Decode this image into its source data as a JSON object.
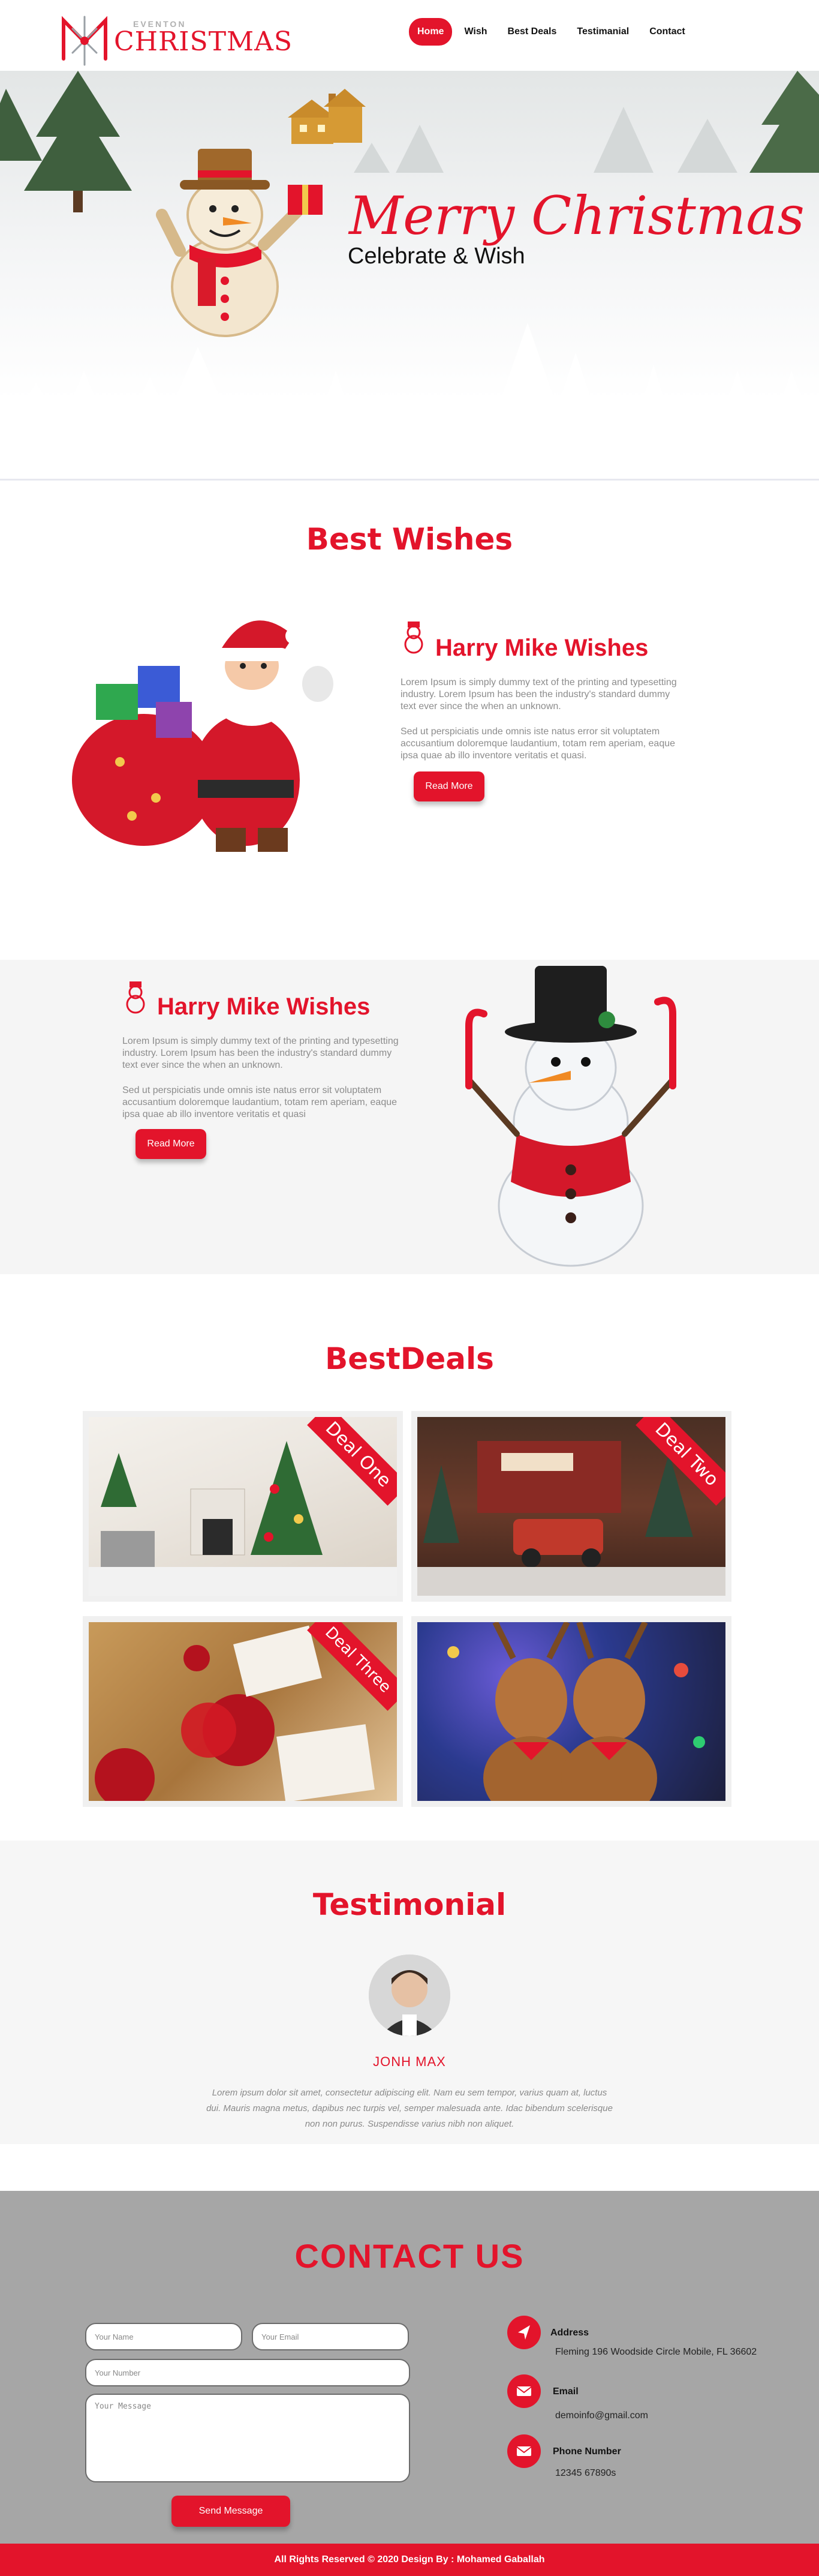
{
  "logo": {
    "sub": "EVENTON",
    "main": "CHRISTMAS"
  },
  "nav": {
    "items": [
      {
        "label": "Home"
      },
      {
        "label": "Wish"
      },
      {
        "label": "Best Deals"
      },
      {
        "label": "Testimanial"
      },
      {
        "label": "Contact"
      }
    ],
    "active": "Home"
  },
  "hero": {
    "title": "Merry Christmas",
    "subtitle": "Celebrate & Wish"
  },
  "best_wishes": {
    "title": "Best Wishes",
    "blocks": [
      {
        "heading": "Harry Mike Wishes",
        "para1": "Lorem Ipsum is simply dummy text of the printing and typesetting industry. Lorem Ipsum has been the industry's standard dummy text ever since the when an unknown.",
        "para2": "Sed ut perspiciatis unde omnis iste natus error sit voluptatem accusantium doloremque laudantium, totam rem aperiam, eaque ipsa quae ab illo inventore veritatis et quasi.",
        "button": "Read More"
      },
      {
        "heading": "Harry Mike Wishes",
        "para1": "Lorem Ipsum is simply dummy text of the printing and typesetting industry. Lorem Ipsum has been the industry's standard dummy text ever since the when an unknown.",
        "para2": "Sed ut perspiciatis unde omnis iste natus error sit voluptatem accusantium doloremque laudantium, totam rem aperiam, eaque ipsa quae ab illo inventore veritatis et quasi",
        "button": "Read More"
      }
    ]
  },
  "deals": {
    "title": "BestDeals",
    "items": [
      {
        "ribbon": "Deal One"
      },
      {
        "ribbon": "Deal Two"
      },
      {
        "ribbon": "Deal Three"
      },
      {
        "ribbon": ""
      }
    ]
  },
  "testimonial": {
    "title": "Testimonial",
    "name": "JONH MAX",
    "text": "Lorem ipsum dolor sit amet, consectetur adipiscing elit. Nam eu sem tempor, varius quam at, luctus dui. Mauris magna metus, dapibus nec turpis vel, semper malesuada ante. Idac bibendum scelerisque non non purus. Suspendisse varius nibh non aliquet."
  },
  "contact": {
    "title": "CONTACT US",
    "placeholders": {
      "name": "Your Name",
      "email": "Your Email",
      "number": "Your Number",
      "message": "Your Message"
    },
    "send_button": "Send Message",
    "info": [
      {
        "label": "Address",
        "value": "Fleming 196 Woodside Circle Mobile, FL 36602",
        "icon": "location-arrow-icon"
      },
      {
        "label": "Email",
        "value": "demoinfo@gmail.com",
        "icon": "envelope-icon"
      },
      {
        "label": "Phone Number",
        "value": "12345 67890s",
        "icon": "envelope-icon"
      }
    ]
  },
  "footer": {
    "text": "All Rights Reserved © 2020   Design By : Mohamed Gaballah"
  },
  "colors": {
    "accent": "#e3142b",
    "contact_bg": "#a6a6a6",
    "band_bg": "#f5f5f5"
  }
}
